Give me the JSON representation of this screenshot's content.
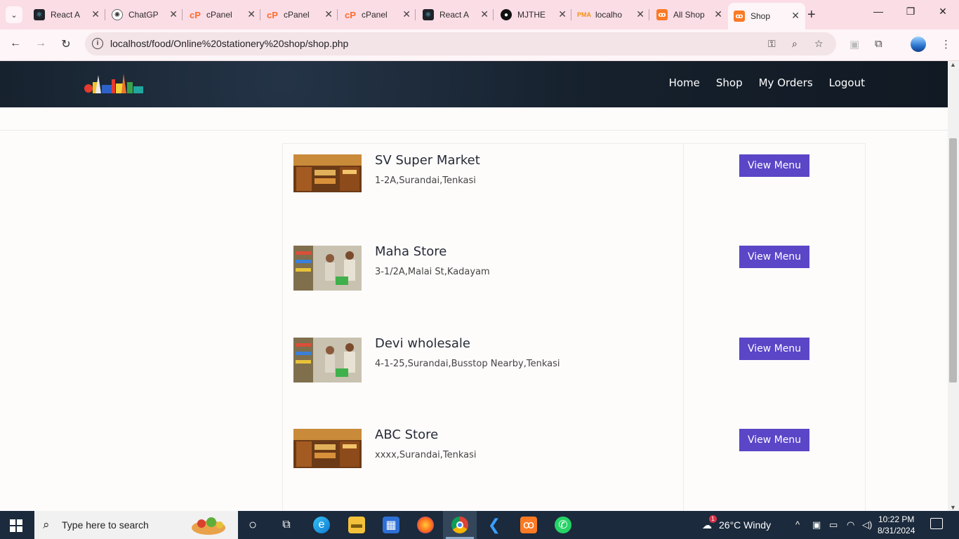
{
  "browser": {
    "tabs": [
      {
        "title": "React A",
        "icon": "react-icon",
        "color": "#61dafb"
      },
      {
        "title": "ChatGP",
        "icon": "chatgpt-icon",
        "color": "#333333"
      },
      {
        "title": "cPanel",
        "icon": "cpanel-icon",
        "color": "#ff6c2c"
      },
      {
        "title": "cPanel",
        "icon": "cpanel-icon",
        "color": "#ff6c2c"
      },
      {
        "title": "cPanel",
        "icon": "cpanel-icon",
        "color": "#ff6c2c"
      },
      {
        "title": "React A",
        "icon": "react-icon",
        "color": "#61dafb"
      },
      {
        "title": "MJTHE",
        "icon": "github-icon",
        "color": "#111111"
      },
      {
        "title": "localho",
        "icon": "phpmyadmin-icon",
        "color": "#f29111"
      },
      {
        "title": "All Shop",
        "icon": "xampp-icon",
        "color": "#fb7a24"
      },
      {
        "title": "Shop",
        "icon": "xampp-icon",
        "color": "#fb7a24"
      }
    ],
    "url": "localhost/food/Online%20stationery%20shop/shop.php"
  },
  "site": {
    "nav": [
      "Home",
      "Shop",
      "My Orders",
      "Logout"
    ]
  },
  "shops": [
    {
      "name": "SV Super Market",
      "address": "1-2A,Surandai,Tenkasi",
      "button": "View Menu",
      "image": "market-aisle"
    },
    {
      "name": "Maha Store",
      "address": "3-1/2A,Malai St,Kadayam",
      "button": "View Menu",
      "image": "family-shopping"
    },
    {
      "name": "Devi wholesale",
      "address": "4-1-25,Surandai,Busstop Nearby,Tenkasi",
      "button": "View Menu",
      "image": "family-shopping"
    },
    {
      "name": "ABC Store",
      "address": "xxxx,Surandai,Tenkasi",
      "button": "View Menu",
      "image": "market-aisle"
    }
  ],
  "taskbar": {
    "search_placeholder": "Type here to search",
    "weather": "26°C  Windy",
    "weather_badge": "1",
    "time": "10:22 PM",
    "date": "8/31/2024"
  },
  "colors": {
    "accent_button": "#5a46c6",
    "nav_bg": "#16212d",
    "tab_strip": "#fbdde6"
  }
}
